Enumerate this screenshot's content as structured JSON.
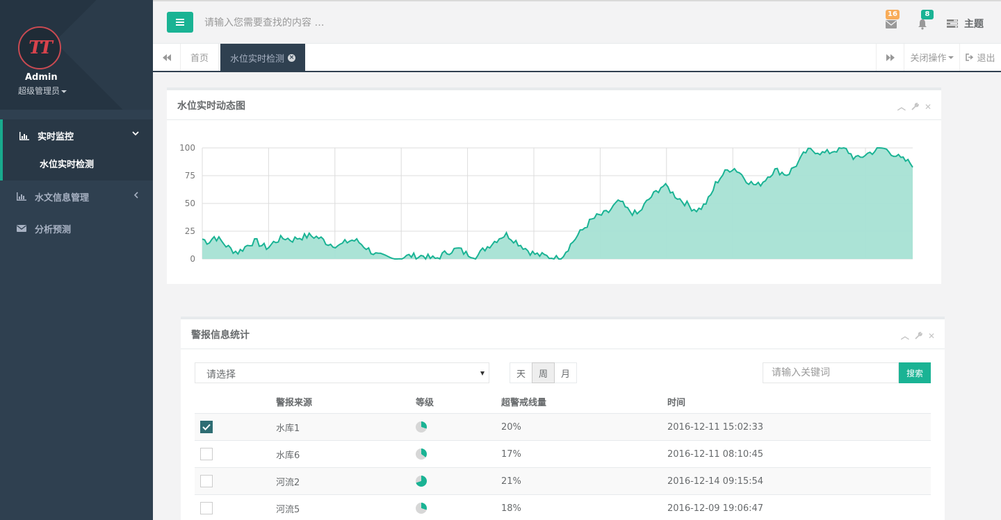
{
  "sidebar": {
    "logo_text": "TT",
    "user_name": "Admin",
    "user_role": "超级管理员",
    "menu": [
      {
        "label": "实时监控",
        "icon": "bar-chart-icon",
        "expanded": true,
        "sub": [
          "水位实时检测"
        ]
      },
      {
        "label": "水文信息管理",
        "icon": "bar-chart-icon"
      },
      {
        "label": "分析预测",
        "icon": "envelope-icon"
      }
    ]
  },
  "topbar": {
    "search_placeholder": "请输入您需要查找的内容 …",
    "mail_count": "16",
    "alert_count": "8",
    "theme_label": "主题",
    "colors": {
      "accent": "#1ab394",
      "mail_badge": "#f8ac59",
      "alert_badge": "#1ab394"
    }
  },
  "tabs": {
    "home": "首页",
    "current": "水位实时检测",
    "close_ops": "关闭操作",
    "exit": "退出"
  },
  "chart_panel": {
    "title": "水位实时动态图",
    "chart_data": {
      "type": "area",
      "yticks": [
        "100",
        "75",
        "50",
        "25",
        "0"
      ],
      "ylim": [
        0,
        100
      ],
      "grid": true,
      "color": "#1ab394",
      "fill": "#a7e2d4",
      "n_points": 300,
      "values_sampled": [
        18,
        15,
        20,
        17,
        12,
        8,
        6,
        10,
        14,
        16,
        12,
        10,
        15,
        18,
        19,
        17,
        19,
        20,
        21,
        20,
        18,
        14,
        13,
        12,
        15,
        17,
        16,
        12,
        8,
        4,
        2,
        1,
        0,
        1,
        2,
        3,
        2,
        3,
        1,
        0,
        3,
        6,
        8,
        9,
        5,
        4,
        2,
        8,
        12,
        16,
        20,
        22,
        18,
        14,
        10,
        6,
        4,
        3,
        2,
        1,
        0,
        8,
        15,
        22,
        28,
        34,
        38,
        40,
        42,
        48,
        52,
        45,
        42,
        40,
        48,
        55,
        60,
        66,
        64,
        58,
        54,
        50,
        46,
        44,
        48,
        55,
        68,
        75,
        80,
        82,
        78,
        72,
        68,
        66,
        70,
        76,
        80,
        78,
        76,
        82,
        88,
        96,
        98,
        97,
        95,
        96,
        98,
        99,
        98,
        92,
        90,
        94,
        96,
        98,
        100,
        97,
        94,
        90,
        88,
        85
      ]
    }
  },
  "alarm_panel": {
    "title": "警报信息统计",
    "select_value": "请选择",
    "period_buttons": [
      "天",
      "周",
      "月"
    ],
    "active_period": "周",
    "keyword_placeholder": "请输入关键词",
    "search_label": "搜索",
    "columns": [
      "警报来源",
      "等级",
      "超警戒线量",
      "时间"
    ],
    "rows": [
      {
        "checked": true,
        "source": "水库1",
        "level": 0.3,
        "amount": "20%",
        "time": "2016-12-11 15:02:33"
      },
      {
        "checked": false,
        "source": "水库6",
        "level": 0.35,
        "amount": "17%",
        "time": "2016-12-11 08:10:45"
      },
      {
        "checked": false,
        "source": "河流2",
        "level": 0.7,
        "amount": "21%",
        "time": "2016-12-14 09:15:54"
      },
      {
        "checked": false,
        "source": "河流5",
        "level": 0.3,
        "amount": "18%",
        "time": "2016-12-09 19:06:47"
      }
    ]
  }
}
